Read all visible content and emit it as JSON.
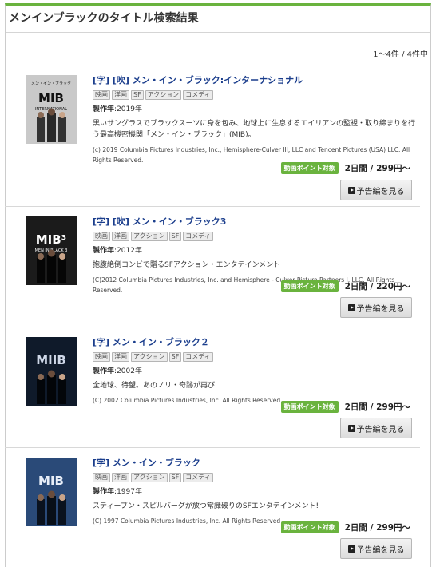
{
  "page": {
    "title": "メンインブラックのタイトル検索結果",
    "count": "1～4件 /  4件中"
  },
  "results": [
    {
      "title": "[字] [吹] メン・イン・ブラック:インターナショナル",
      "tags": [
        "映画",
        "洋画",
        "SF",
        "アクション",
        "コメディ"
      ],
      "year_label": "製作年",
      "year": "2019年",
      "description": "黒いサングラスでブラックスーツに身を包み、地球上に生息するエイリアンの監視・取り締まりを行う最高機密機関「メン・イン・ブラック」(MIB)。",
      "copyright": "(c) 2019 Columbia Pictures Industries, Inc., Hemisphere-Culver III, LLC and Tencent Pictures (USA) LLC. All Rights Reserved.",
      "badge": "動画ポイント対象",
      "price": "2日間 / 299円～",
      "trailer_label": "予告編を見る",
      "poster": {
        "top_text": "メン・イン・ブラック",
        "logo": "MIB",
        "sub": "INTERNATIONAL",
        "bg": "#c9c9c9",
        "fg": "#111111"
      }
    },
    {
      "title": "[字] [吹] メン・イン・ブラック3",
      "tags": [
        "映画",
        "洋画",
        "アクション",
        "SF",
        "コメディ"
      ],
      "year_label": "製作年",
      "year": "2012年",
      "description": "抱腹絶倒コンビで贈るSFアクション・エンタテインメント",
      "copyright": "(C)2012 Columbia Pictures Industries, Inc. and Hemisphere - Culver Picture Partners I, LLC. All Rights Reserved.",
      "badge": "動画ポイント対象",
      "price": "2日間 / 220円～",
      "trailer_label": "予告編を見る",
      "poster": {
        "top_text": "",
        "logo": "MIB³",
        "sub": "MEN IN BLACK 3",
        "bg": "#1b1b1b",
        "fg": "#ffffff"
      }
    },
    {
      "title": "[字] メン・イン・ブラック２",
      "tags": [
        "映画",
        "洋画",
        "アクション",
        "SF",
        "コメディ"
      ],
      "year_label": "製作年",
      "year": "2002年",
      "description": "全地球、待望。あのノリ・奇跡が再び",
      "copyright": "(C) 2002 Columbia Pictures Industries, Inc. All Rights Reserved",
      "badge": "動画ポイント対象",
      "price": "2日間 / 299円～",
      "trailer_label": "予告編を見る",
      "poster": {
        "top_text": "",
        "logo": "MIIB",
        "sub": "",
        "bg": "#0f1a2a",
        "fg": "#cfd8e8"
      }
    },
    {
      "title": "[字] メン・イン・ブラック",
      "tags": [
        "映画",
        "洋画",
        "アクション",
        "SF",
        "コメディ"
      ],
      "year_label": "製作年",
      "year": "1997年",
      "description": "スティーブン・スピルバーグが放つ常識破りのSFエンタテインメント!",
      "copyright": "(C) 1997 Columbia Pictures Industries, Inc. All Rights Reserved",
      "badge": "動画ポイント対象",
      "price": "2日間 / 299円～",
      "trailer_label": "予告編を見る",
      "poster": {
        "top_text": "",
        "logo": "MIB",
        "sub": "",
        "bg": "#2a4a78",
        "fg": "#e8eef8"
      }
    }
  ],
  "colors": {
    "accent_green": "#6ab33e",
    "link_blue": "#1a3d8c"
  },
  "icons": {
    "trailer": "play-icon"
  }
}
